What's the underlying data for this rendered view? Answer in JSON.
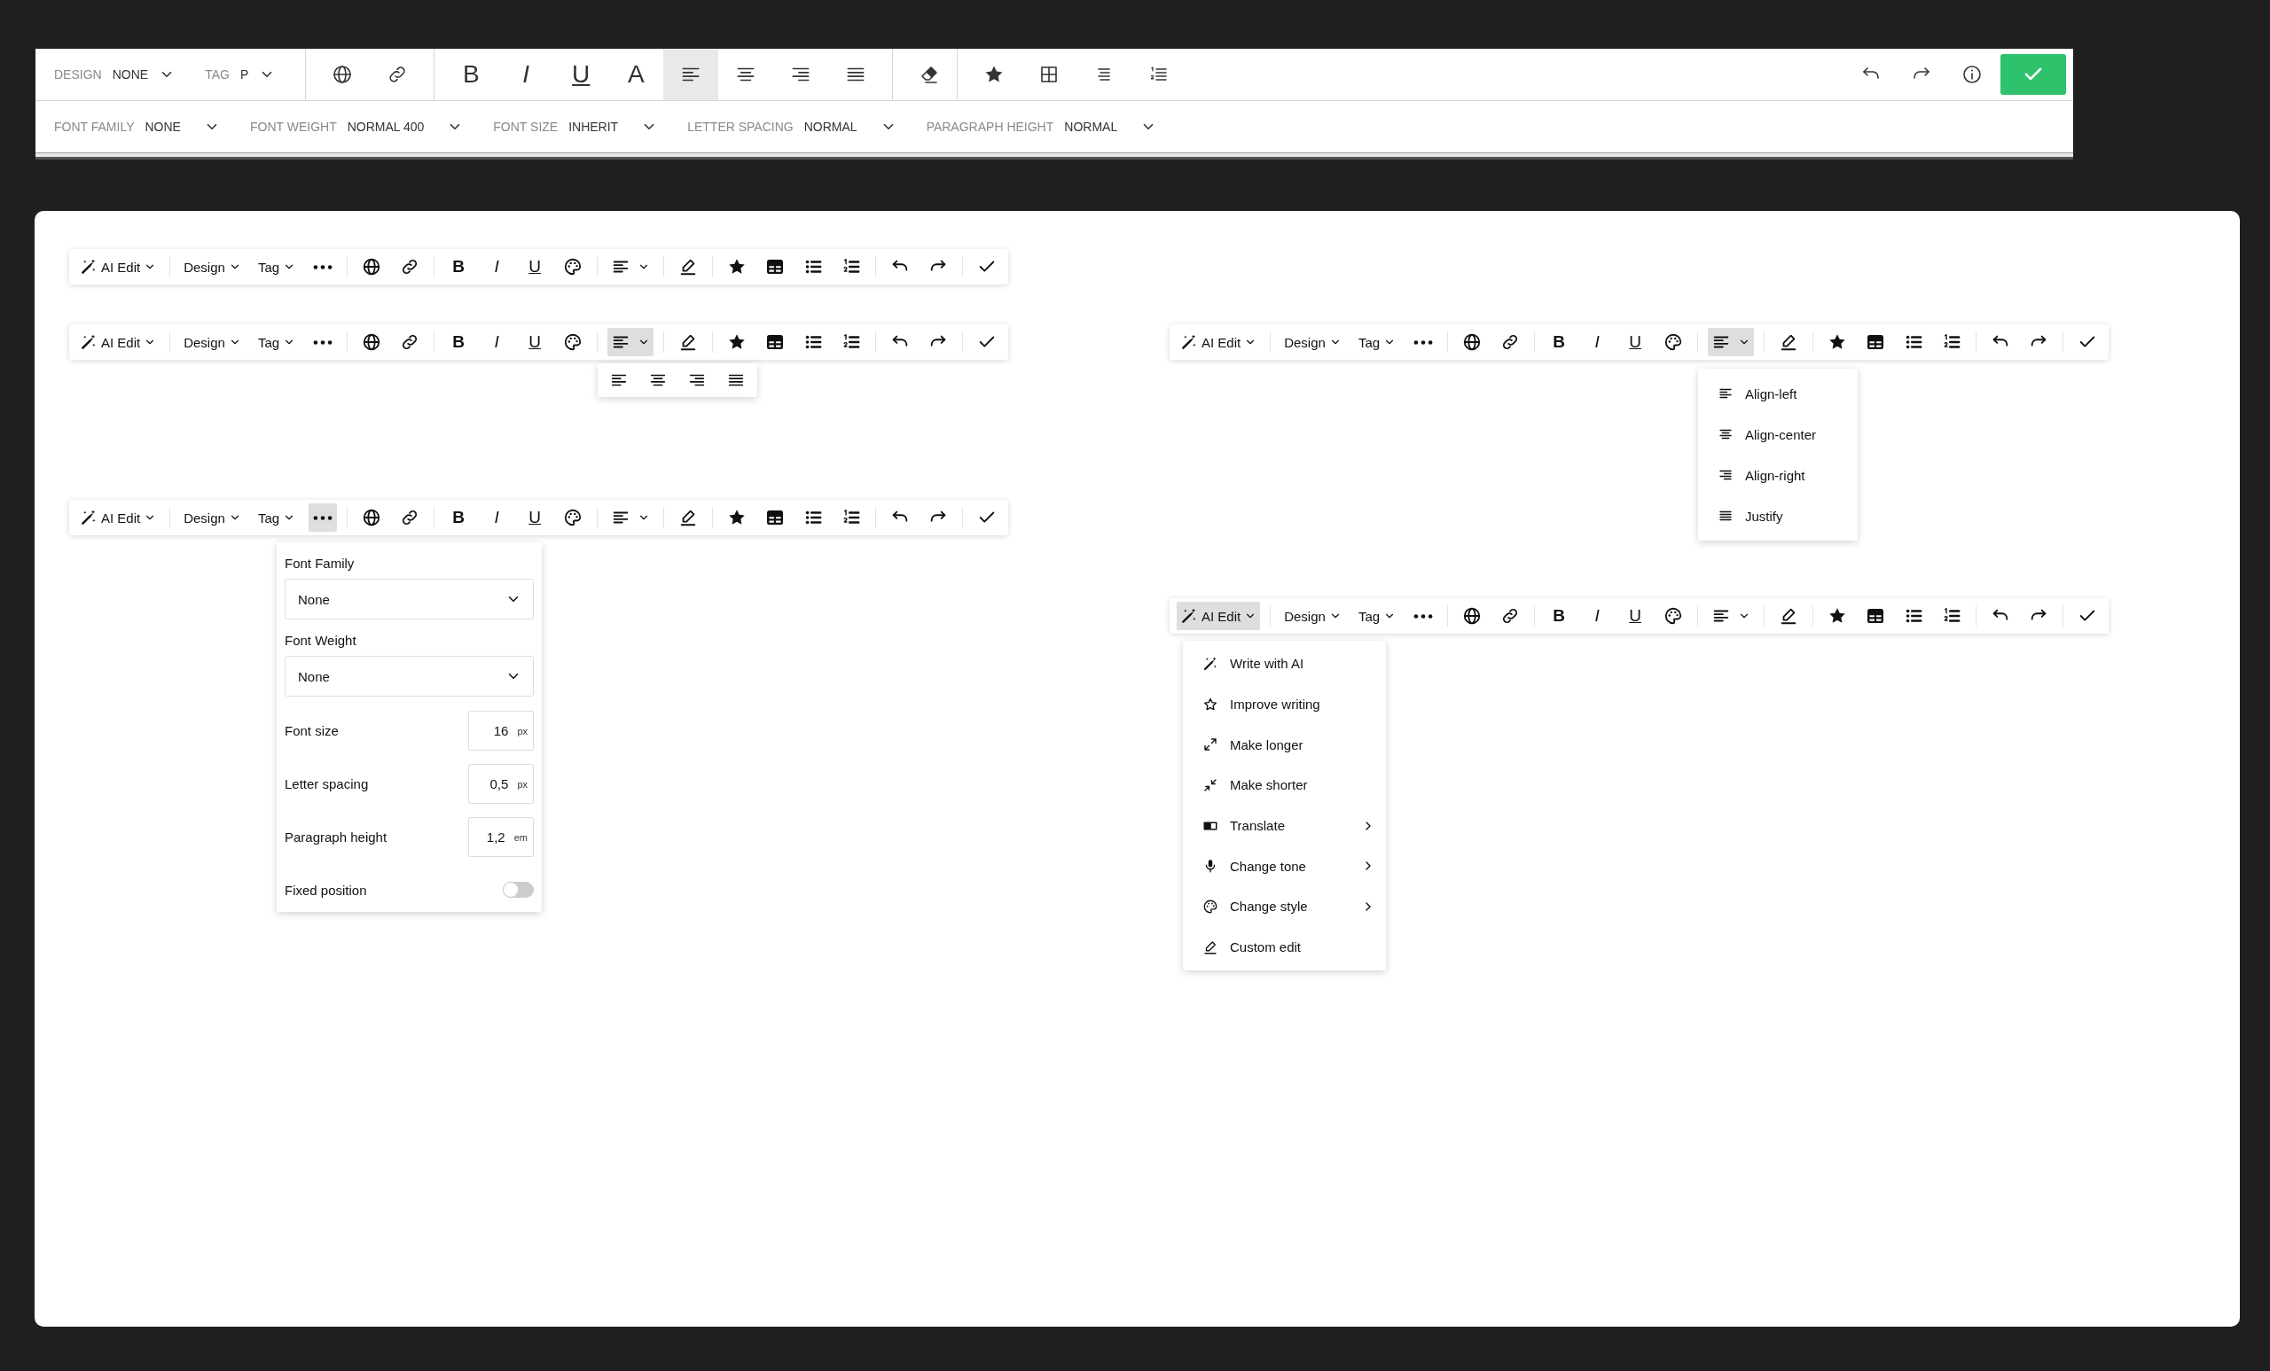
{
  "editor_bar": {
    "selectors": [
      {
        "label": "DESIGN",
        "value": "NONE"
      },
      {
        "label": "TAG",
        "value": "P"
      }
    ],
    "format_buttons": [
      {
        "kind": "bold",
        "glyph": "B"
      },
      {
        "kind": "italic",
        "glyph": "I"
      },
      {
        "kind": "underline",
        "glyph": "U"
      },
      {
        "kind": "color",
        "glyph": "A"
      }
    ],
    "alignments": [
      {
        "kind": "left",
        "selected": true
      },
      {
        "kind": "center",
        "selected": false
      },
      {
        "kind": "right",
        "selected": false
      },
      {
        "kind": "justify",
        "selected": false
      }
    ],
    "style_fields": [
      {
        "label": "FONT FAMILY",
        "value": "NONE"
      },
      {
        "label": "FONT WEIGHT",
        "value": "NORMAL 400"
      },
      {
        "label": "FONT SIZE",
        "value": "INHERIT"
      },
      {
        "label": "LETTER SPACING",
        "value": "NORMAL"
      },
      {
        "label": "PARAGRAPH HEIGHT",
        "value": "NORMAL"
      }
    ]
  },
  "left_column": [
    {
      "ai_edit": {
        "label": "AI Edit",
        "selected": false
      },
      "design": "Design",
      "tag": "Tag",
      "more_selected": false,
      "align_selected": false,
      "format_buttons": [
        {
          "kind": "bold",
          "glyph": "B"
        },
        {
          "kind": "italic",
          "glyph": "I"
        },
        {
          "kind": "underline",
          "glyph": "U"
        }
      ]
    },
    {
      "ai_edit": {
        "label": "AI Edit",
        "selected": false
      },
      "design": "Design",
      "tag": "Tag",
      "more_selected": false,
      "align_selected": true,
      "format_buttons": [
        {
          "kind": "bold",
          "glyph": "B"
        },
        {
          "kind": "italic",
          "glyph": "I"
        },
        {
          "kind": "underline",
          "glyph": "U"
        }
      ],
      "popup": {
        "kind": "align_icons"
      }
    },
    {
      "ai_edit": {
        "label": "AI Edit",
        "selected": false
      },
      "design": "Design",
      "tag": "Tag",
      "more_selected": true,
      "align_selected": false,
      "format_buttons": [
        {
          "kind": "bold",
          "glyph": "B"
        },
        {
          "kind": "italic",
          "glyph": "I"
        },
        {
          "kind": "underline",
          "glyph": "U"
        }
      ],
      "popup": {
        "kind": "font_settings",
        "selects": [
          {
            "label": "Font Family",
            "value": "None"
          },
          {
            "label": "Font Weight",
            "value": "None"
          }
        ],
        "inputs": [
          {
            "label": "Font size",
            "value": "16",
            "unit": "px"
          },
          {
            "label": "Letter spacing",
            "value": "0,5",
            "unit": "px"
          },
          {
            "label": "Paragraph height",
            "value": "1,2",
            "unit": "em"
          }
        ],
        "toggle": {
          "label": "Fixed position",
          "on": false
        }
      }
    }
  ],
  "right_column": [
    {
      "ai_edit": {
        "label": "AI Edit",
        "selected": false
      },
      "design": "Design",
      "tag": "Tag",
      "more_selected": false,
      "align_selected": true,
      "format_buttons": [
        {
          "kind": "bold",
          "glyph": "B"
        },
        {
          "kind": "italic",
          "glyph": "I"
        },
        {
          "kind": "underline",
          "glyph": "U"
        }
      ],
      "popup": {
        "kind": "align_menu",
        "items": [
          {
            "kind": "left",
            "label": "Align-left"
          },
          {
            "kind": "center",
            "label": "Align-center"
          },
          {
            "kind": "right",
            "label": "Align-right"
          },
          {
            "kind": "justify",
            "label": "Justify"
          }
        ]
      }
    },
    {
      "ai_edit": {
        "label": "AI Edit",
        "selected": true
      },
      "design": "Design",
      "tag": "Tag",
      "more_selected": false,
      "align_selected": false,
      "format_buttons": [
        {
          "kind": "bold",
          "glyph": "B"
        },
        {
          "kind": "italic",
          "glyph": "I"
        },
        {
          "kind": "underline",
          "glyph": "U"
        }
      ],
      "popup": {
        "kind": "ai_menu",
        "items": [
          {
            "kind": "write",
            "label": "Write with AI",
            "submenu": false
          },
          {
            "kind": "improve",
            "label": "Improve writing",
            "submenu": false
          },
          {
            "kind": "longer",
            "label": "Make longer",
            "submenu": false
          },
          {
            "kind": "shorter",
            "label": "Make shorter",
            "submenu": false
          },
          {
            "kind": "translate",
            "label": "Translate",
            "submenu": true
          },
          {
            "kind": "tone",
            "label": "Change tone",
            "submenu": true
          },
          {
            "kind": "style",
            "label": "Change style",
            "submenu": true
          },
          {
            "kind": "custom",
            "label": "Custom edit",
            "submenu": false
          }
        ]
      }
    }
  ]
}
